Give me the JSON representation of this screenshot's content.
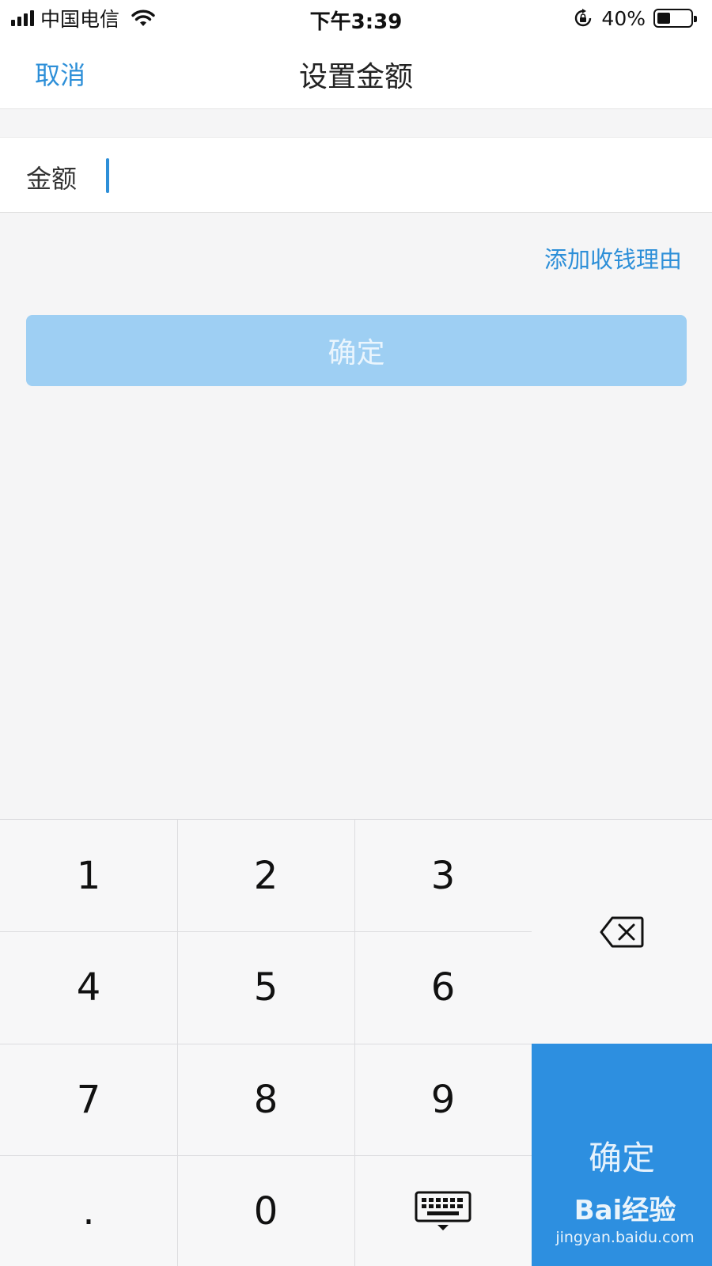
{
  "status_bar": {
    "carrier": "中国电信",
    "time": "下午3:39",
    "battery_percent": "40%",
    "battery_level": 0.4
  },
  "nav": {
    "cancel_label": "取消",
    "title": "设置金额"
  },
  "amount": {
    "label": "金额",
    "value": ""
  },
  "add_reason_label": "添加收钱理由",
  "confirm_label": "确定",
  "keypad": {
    "keys": [
      "1",
      "2",
      "3",
      "4",
      "5",
      "6",
      "7",
      "8",
      "9",
      ".",
      "0"
    ],
    "confirm_label": "确定",
    "delete_icon": "backspace-icon",
    "hide_icon": "keyboard-hide-icon"
  },
  "watermark": {
    "logo": "Bai经验",
    "url": "jingyan.baidu.com"
  },
  "colors": {
    "accent": "#2d8fd8",
    "confirm_disabled": "#9ecff3",
    "keypad_confirm": "#2d8fe0"
  }
}
